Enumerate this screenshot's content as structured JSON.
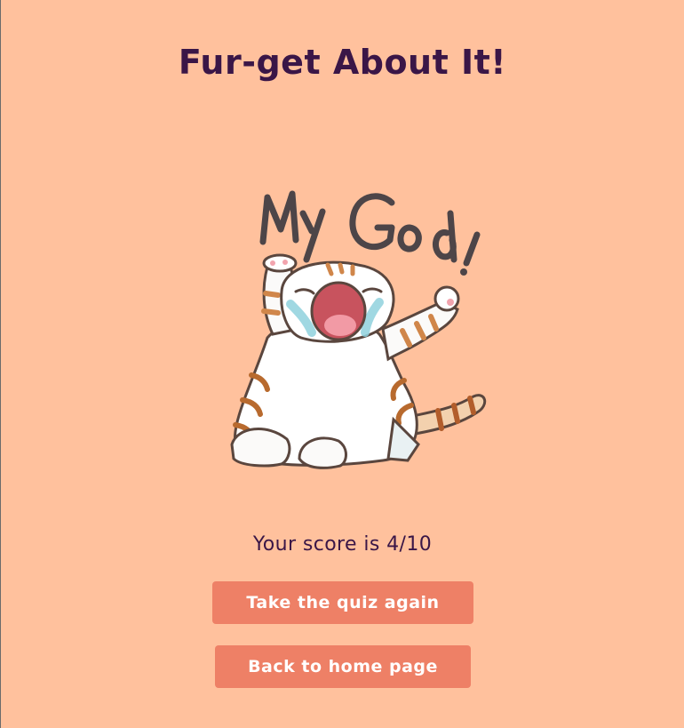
{
  "header": {
    "title": "Fur-get About It!"
  },
  "result": {
    "sticker_icon": "crying-cat-sticker-icon",
    "sticker_text": "My God!",
    "score_text": "Your score is 4/10",
    "score": 4,
    "score_max": 10
  },
  "actions": {
    "retry_label": "Take the quiz again",
    "home_label": "Back to home page"
  },
  "colors": {
    "background": "#FFC19D",
    "title_text": "#3A1647",
    "button_bg": "#EE8066",
    "button_text": "#FFFFFF"
  }
}
